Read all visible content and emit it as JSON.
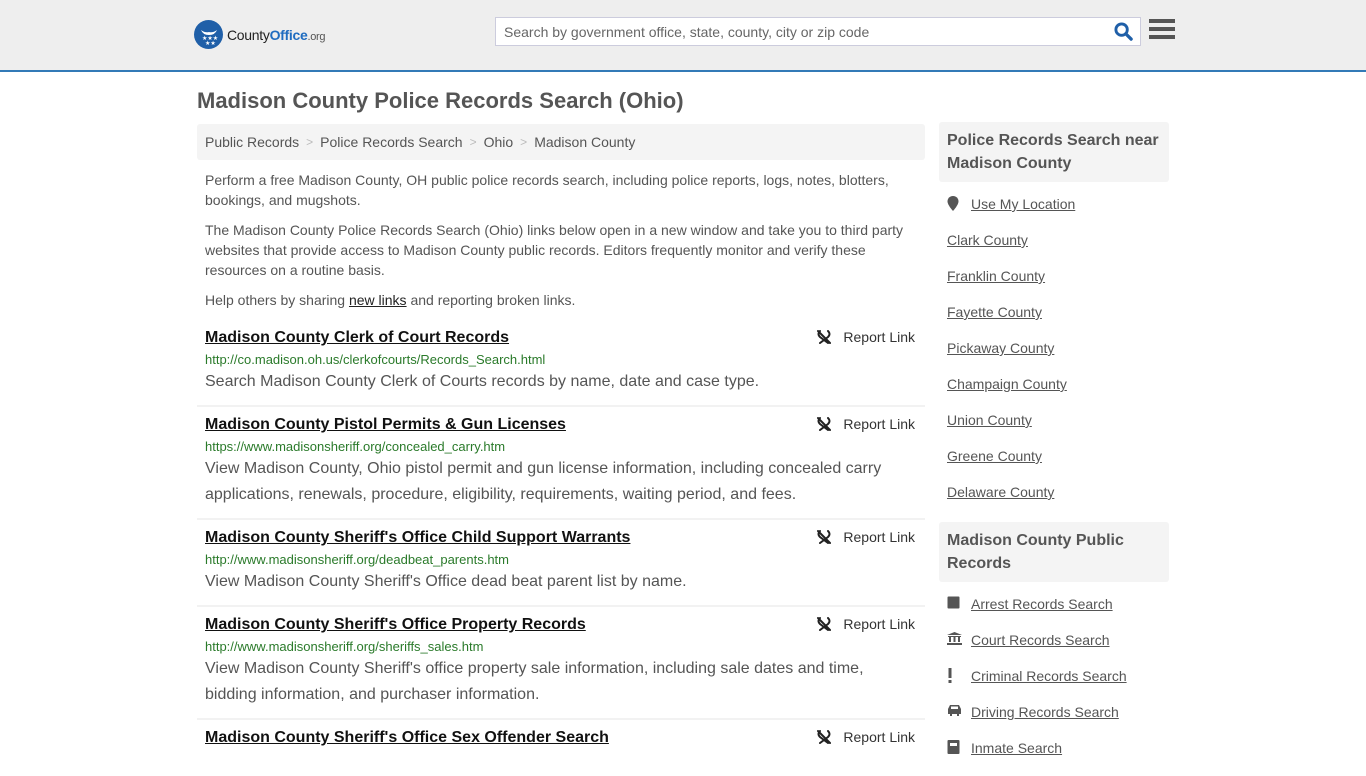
{
  "header": {
    "logo": {
      "name_part1": "County",
      "name_part2": "Office",
      "name_part3": ".org"
    },
    "search": {
      "placeholder": "Search by government office, state, county, city or zip code",
      "value": ""
    },
    "search_icon": "search-icon",
    "menu_icon": "hamburger-menu-icon"
  },
  "page": {
    "title": "Madison County Police Records Search (Ohio)"
  },
  "breadcrumb": [
    {
      "label": "Public Records"
    },
    {
      "label": "Police Records Search"
    },
    {
      "label": "Ohio"
    },
    {
      "label": "Madison County"
    }
  ],
  "breadcrumb_separator": ">",
  "intro": {
    "p1": "Perform a free Madison County, OH public police records search, including police reports, logs, notes, blotters, bookings, and mugshots.",
    "p2": "The Madison County Police Records Search (Ohio) links below open in a new window and take you to third party websites that provide access to Madison County public records. Editors frequently monitor and verify these resources on a routine basis.",
    "p3_before": "Help others by sharing ",
    "p3_link": "new links",
    "p3_after": " and reporting broken links."
  },
  "report_label": "Report Link",
  "results": [
    {
      "title": "Madison County Clerk of Court Records",
      "url": "http://co.madison.oh.us/clerkofcourts/Records_Search.html",
      "description": "Search Madison County Clerk of Courts records by name, date and case type."
    },
    {
      "title": "Madison County Pistol Permits & Gun Licenses",
      "url": "https://www.madisonsheriff.org/concealed_carry.htm",
      "description": "View Madison County, Ohio pistol permit and gun license information, including concealed carry applications, renewals, procedure, eligibility, requirements, waiting period, and fees."
    },
    {
      "title": "Madison County Sheriff's Office Child Support Warrants",
      "url": "http://www.madisonsheriff.org/deadbeat_parents.htm",
      "description": "View Madison County Sheriff's Office dead beat parent list by name."
    },
    {
      "title": "Madison County Sheriff's Office Property Records",
      "url": "http://www.madisonsheriff.org/sheriffs_sales.htm",
      "description": "View Madison County Sheriff's office property sale information, including sale dates and time, bidding information, and purchaser information."
    },
    {
      "title": "Madison County Sheriff's Office Sex Offender Search",
      "url": "",
      "description": ""
    }
  ],
  "sidebar": {
    "nearby": {
      "heading": "Police Records Search near Madison County",
      "use_location": "Use My Location",
      "counties": [
        "Clark County",
        "Franklin County",
        "Fayette County",
        "Pickaway County",
        "Champaign County",
        "Union County",
        "Greene County",
        "Delaware County"
      ]
    },
    "public_records": {
      "heading": "Madison County Public Records",
      "items": [
        {
          "label": "Arrest Records Search",
          "icon": "book-icon"
        },
        {
          "label": "Court Records Search",
          "icon": "courthouse-icon"
        },
        {
          "label": "Criminal Records Search",
          "icon": "exclamation-icon"
        },
        {
          "label": "Driving Records Search",
          "icon": "car-icon"
        },
        {
          "label": "Inmate Search",
          "icon": "inmate-icon"
        }
      ]
    }
  }
}
